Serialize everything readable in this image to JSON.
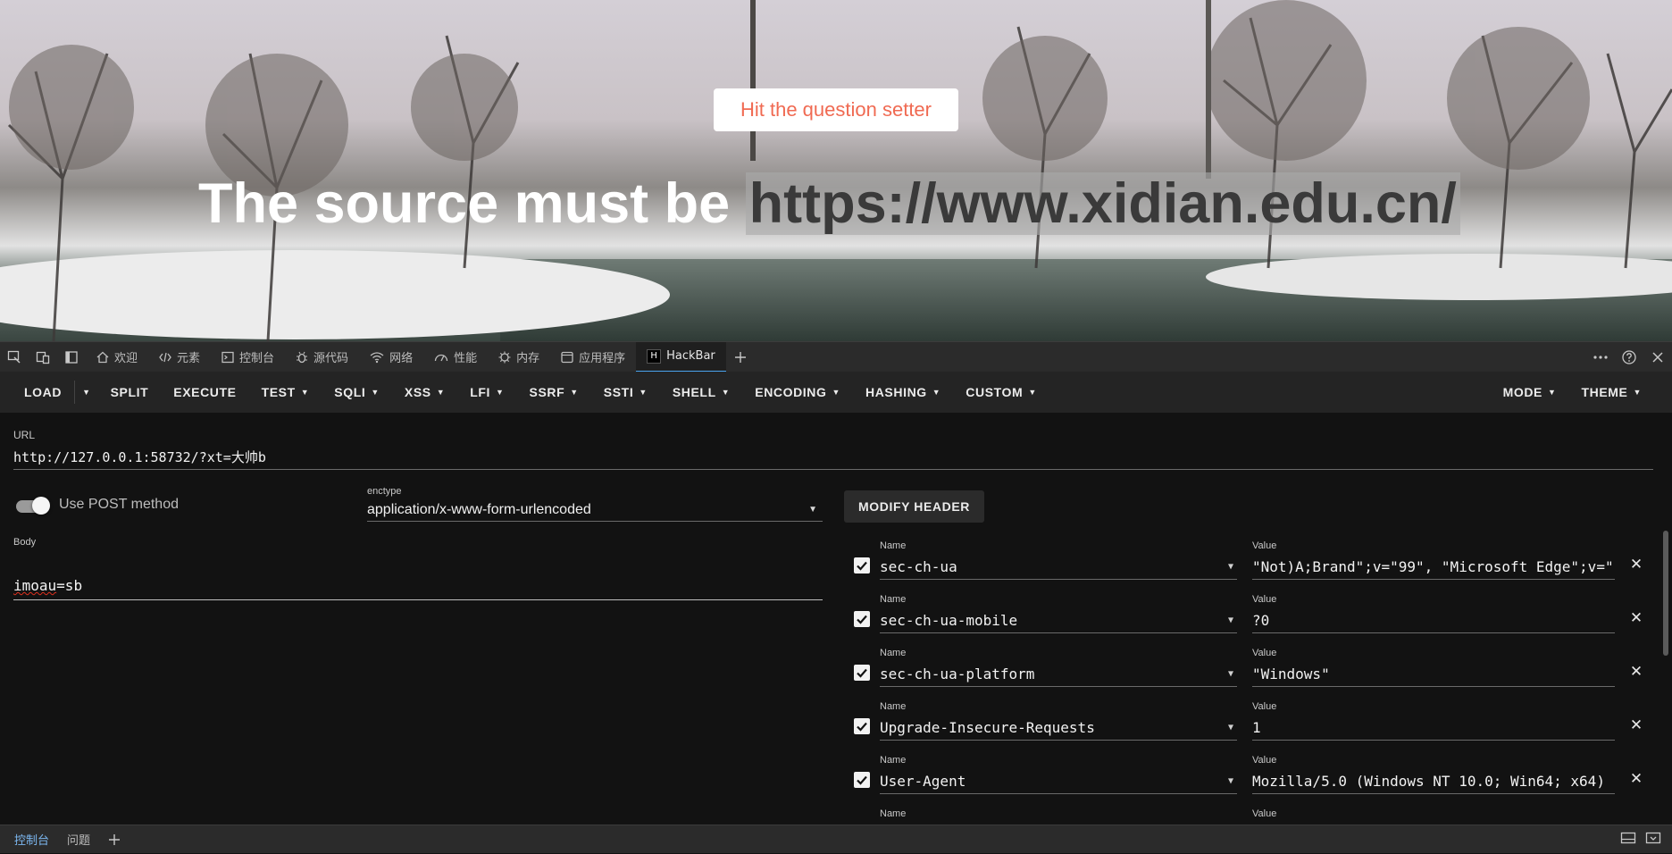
{
  "page": {
    "hit_button": "Hit the question setter",
    "headline_prefix": "The source must be ",
    "headline_source": "https://www.xidian.edu.cn/"
  },
  "devtools": {
    "tabs": [
      {
        "label": "欢迎",
        "icon": "home-icon"
      },
      {
        "label": "元素",
        "icon": "code-icon"
      },
      {
        "label": "控制台",
        "icon": "console-icon"
      },
      {
        "label": "源代码",
        "icon": "bug-icon"
      },
      {
        "label": "网络",
        "icon": "wifi-icon"
      },
      {
        "label": "性能",
        "icon": "performance-icon"
      },
      {
        "label": "内存",
        "icon": "memory-icon"
      },
      {
        "label": "应用程序",
        "icon": "application-icon"
      },
      {
        "label": "HackBar",
        "icon": "hackbar-icon",
        "active": true
      }
    ]
  },
  "hackbar": {
    "menu": {
      "load": "LOAD",
      "split": "SPLIT",
      "execute": "EXECUTE",
      "test": "TEST",
      "sqli": "SQLI",
      "xss": "XSS",
      "lfi": "LFI",
      "ssrf": "SSRF",
      "ssti": "SSTI",
      "shell": "SHELL",
      "encoding": "ENCODING",
      "hashing": "HASHING",
      "custom": "CUSTOM",
      "mode": "MODE",
      "theme": "THEME"
    },
    "url_label": "URL",
    "url_value": "http://127.0.0.1:58732/?xt=大帅b",
    "post_toggle_label": "Use POST method",
    "post_enabled": true,
    "enctype_label": "enctype",
    "enctype_value": "application/x-www-form-urlencoded",
    "body_label": "Body",
    "body_value_misspelled": "imoau",
    "body_value_rest": "=sb",
    "modify_header_label": "MODIFY HEADER",
    "name_label": "Name",
    "value_label": "Value",
    "headers": [
      {
        "name": "sec-ch-ua",
        "value": "\"Not)A;Brand\";v=\"99\", \"Microsoft Edge\";v=\"",
        "checked": true
      },
      {
        "name": "sec-ch-ua-mobile",
        "value": "?0",
        "checked": true
      },
      {
        "name": "sec-ch-ua-platform",
        "value": "\"Windows\"",
        "checked": true
      },
      {
        "name": "Upgrade-Insecure-Requests",
        "value": "1",
        "checked": true
      },
      {
        "name": "User-Agent",
        "value": "Mozilla/5.0 (Windows NT 10.0; Win64; x64)",
        "checked": true
      },
      {
        "name": "",
        "value": "",
        "checked": true
      }
    ]
  },
  "drawer": {
    "tabs": [
      "控制台",
      "问题"
    ]
  }
}
